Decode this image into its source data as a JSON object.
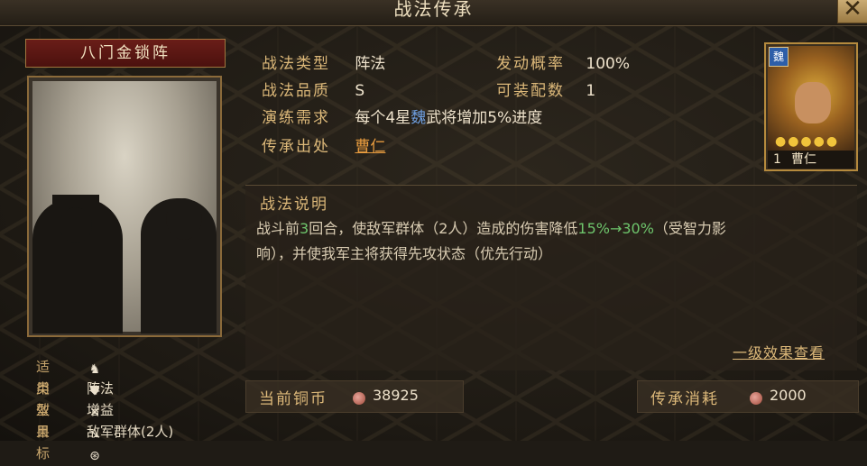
{
  "header": {
    "title": "战法传承",
    "close_label": "✕"
  },
  "skill": {
    "name": "八门金锁阵"
  },
  "stats": {
    "rows": [
      {
        "label": "适用",
        "value": ""
      },
      {
        "label": "类型",
        "value": "阵法"
      },
      {
        "label": "效果",
        "value": "增益"
      },
      {
        "label": "目标",
        "value": "敌军群体(2人)"
      }
    ],
    "applicable_icons": [
      "cavalry-icon",
      "shield-icon",
      "bow-icon",
      "spear-icon",
      "chariot-icon"
    ]
  },
  "info": {
    "type_label": "战法类型",
    "type_value": "阵法",
    "quality_label": "战法品质",
    "quality_value": "S",
    "train_label": "演练需求",
    "train_value_pre": "每个4星",
    "train_value_faction": "魏",
    "train_value_post": "武将增加5%进度",
    "origin_label": "传承出处",
    "origin_value": "曹仁",
    "rate_label": "发动概率",
    "rate_value": "100%",
    "equip_label": "可装配数",
    "equip_value": "1"
  },
  "hero": {
    "faction": "魏",
    "stars": "●●●●●",
    "level": "1",
    "name": "曹仁"
  },
  "description": {
    "title": "战法说明",
    "t1": "战斗前",
    "rounds": "3",
    "t2": "回合，使敌军群体（2人）造成的伤害降低",
    "range": "15%→30%",
    "t3": "（受智力影",
    "line2": "响），并使我军主将获得先攻状态（优先行动）",
    "more_link": "一级效果查看"
  },
  "currency": {
    "current_label": "当前铜币",
    "current_value": "38925",
    "cost_label": "传承消耗",
    "cost_value": "2000"
  },
  "colors": {
    "accent": "#dcb879",
    "green": "#6ec56c",
    "faction_blue": "#6f9fe0"
  }
}
